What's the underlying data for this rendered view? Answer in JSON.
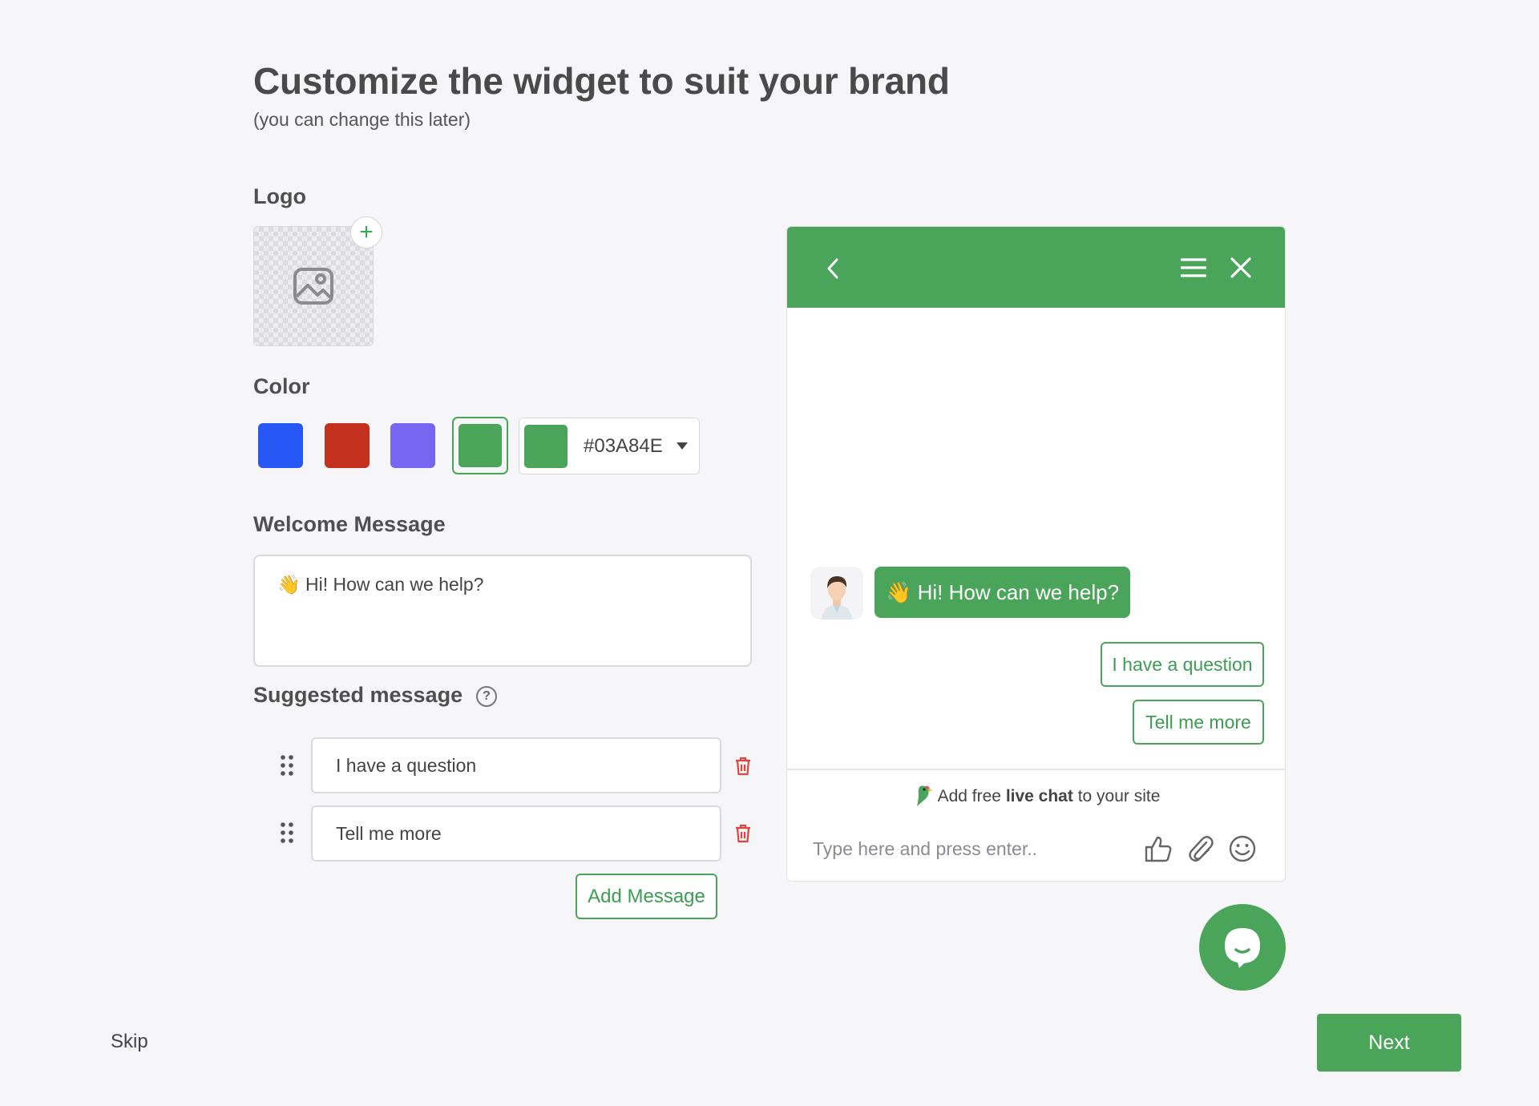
{
  "header": {
    "title": "Customize the widget to suit your brand",
    "subtitle": "(you can change this later)"
  },
  "logo": {
    "label": "Logo",
    "upload_icon": "image-icon",
    "add_icon": "plus-icon",
    "add_symbol": "+"
  },
  "color": {
    "label": "Color",
    "swatches": [
      "#2657f5",
      "#c3311e",
      "#7766f2",
      "#4aa55b"
    ],
    "selected_index": 3,
    "custom_value": "#03A84E",
    "dropdown_icon": "caret-down-icon"
  },
  "welcome": {
    "label": "Welcome Message",
    "value": "👋 Hi! How can we help?"
  },
  "suggested": {
    "label": "Suggested message",
    "help_symbol": "?",
    "items": [
      {
        "value": "I have a question"
      },
      {
        "value": "Tell me more"
      }
    ],
    "add_label": "Add Message"
  },
  "preview": {
    "accent": "#4aa55b",
    "header_icons": [
      "back-arrow-icon",
      "menu-icon",
      "close-icon"
    ],
    "agent_message": "👋 Hi! How can we help?",
    "suggestions": [
      "I have a question",
      "Tell me more"
    ],
    "promo_prefix": "Add free ",
    "promo_bold": "live chat",
    "promo_suffix": " to your site",
    "input_placeholder": "Type here and press enter..",
    "input_icons": [
      "thumbs-up-icon",
      "paperclip-icon",
      "emoji-icon"
    ]
  },
  "footer": {
    "skip_label": "Skip",
    "next_label": "Next"
  }
}
